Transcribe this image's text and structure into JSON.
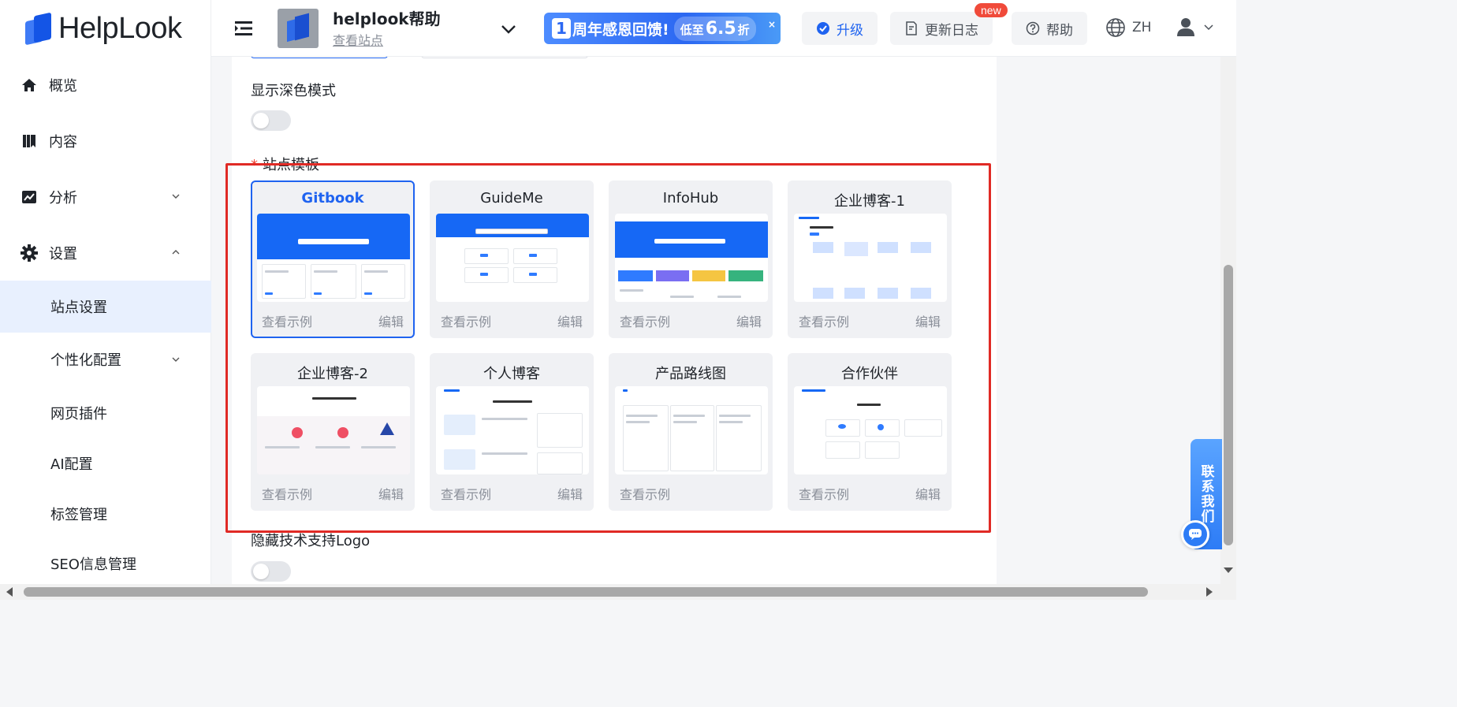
{
  "brand": {
    "logo_text": "HelpLook"
  },
  "sidebar": {
    "items": [
      {
        "label": "概览",
        "icon": "home-icon"
      },
      {
        "label": "内容",
        "icon": "book-icon"
      },
      {
        "label": "分析",
        "icon": "chart-icon"
      },
      {
        "label": "设置",
        "icon": "gear-icon"
      }
    ],
    "sub_items": [
      {
        "label": "站点设置",
        "active": true
      },
      {
        "label": "个性化配置"
      },
      {
        "label": "网页插件"
      },
      {
        "label": "AI配置"
      },
      {
        "label": "标签管理"
      },
      {
        "label": "SEO信息管理"
      }
    ]
  },
  "header": {
    "site_name": "helplook帮助",
    "view_site": "查看站点",
    "promo": {
      "num": "1",
      "text": "周年感恩回馈!",
      "pill_prefix": "低至",
      "pill_value": "6.5",
      "pill_suffix": "折",
      "close": "×"
    },
    "upgrade": "升级",
    "changelog": "更新日志",
    "new_badge": "new",
    "help": "帮助",
    "lang": "ZH"
  },
  "settings": {
    "dark_mode_label": "显示深色模式",
    "template_label": "站点模板",
    "required_mark": "*",
    "hide_logo_label": "隐藏技术支持Logo",
    "dark_mode_on": false,
    "hide_logo_on": false
  },
  "templates": [
    {
      "name": "Gitbook",
      "view": "查看示例",
      "edit": "编辑",
      "selected": true
    },
    {
      "name": "GuideMe",
      "view": "查看示例",
      "edit": "编辑"
    },
    {
      "name": "InfoHub",
      "view": "查看示例",
      "edit": "编辑"
    },
    {
      "name": "企业博客-1",
      "view": "查看示例",
      "edit": "编辑"
    },
    {
      "name": "企业博客-2",
      "view": "查看示例",
      "edit": "编辑"
    },
    {
      "name": "个人博客",
      "view": "查看示例",
      "edit": "编辑"
    },
    {
      "name": "产品路线图",
      "view": "查看示例",
      "edit": ""
    },
    {
      "name": "合作伙伴",
      "view": "查看示例",
      "edit": "编辑"
    }
  ],
  "float": {
    "contact": "联系我们"
  },
  "colors": {
    "accent": "#1f63f0",
    "highlight_box": "#e02a25"
  }
}
